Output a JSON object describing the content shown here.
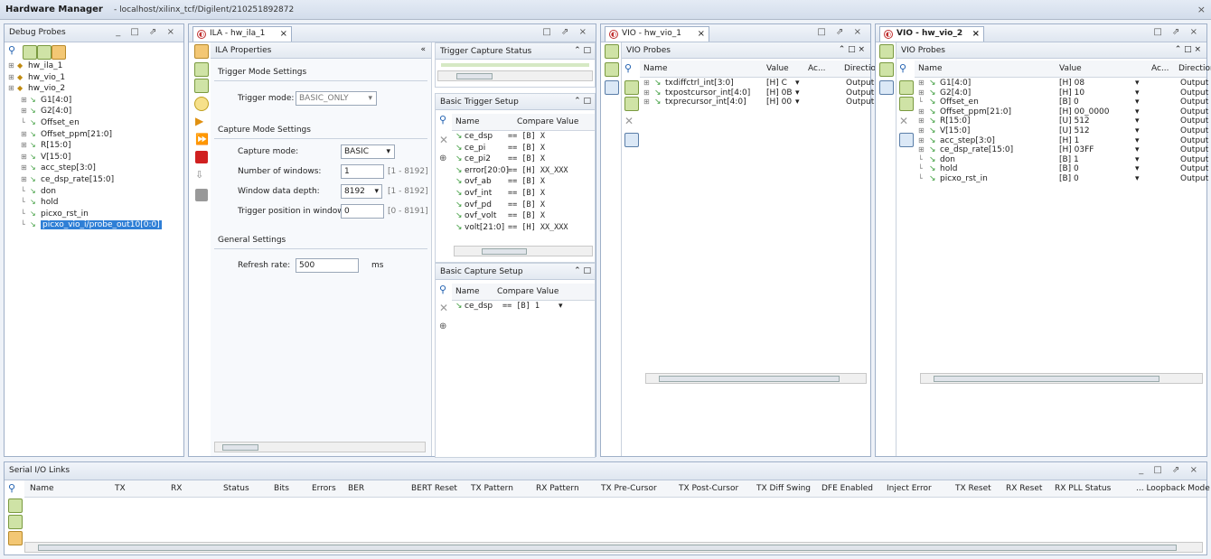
{
  "window": {
    "title": "Hardware Manager",
    "subtitle": "- localhost/xilinx_tcf/Digilent/210251892872",
    "close": "×"
  },
  "debug_probes": {
    "title": "Debug Probes",
    "controls": "_ □ ⇗ ×",
    "tree": [
      {
        "label": "hw_ila_1",
        "indent": 0,
        "kind": "core"
      },
      {
        "label": "hw_vio_1",
        "indent": 0,
        "kind": "core"
      },
      {
        "label": "hw_vio_2",
        "indent": 0,
        "kind": "core"
      },
      {
        "label": "G1[4:0]",
        "indent": 1,
        "kind": "bus"
      },
      {
        "label": "G2[4:0]",
        "indent": 1,
        "kind": "bus"
      },
      {
        "label": "Offset_en",
        "indent": 1,
        "kind": "sig"
      },
      {
        "label": "Offset_ppm[21:0]",
        "indent": 1,
        "kind": "bus"
      },
      {
        "label": "R[15:0]",
        "indent": 1,
        "kind": "bus"
      },
      {
        "label": "V[15:0]",
        "indent": 1,
        "kind": "bus"
      },
      {
        "label": "acc_step[3:0]",
        "indent": 1,
        "kind": "bus"
      },
      {
        "label": "ce_dsp_rate[15:0]",
        "indent": 1,
        "kind": "bus"
      },
      {
        "label": "don",
        "indent": 1,
        "kind": "sig"
      },
      {
        "label": "hold",
        "indent": 1,
        "kind": "sig"
      },
      {
        "label": "picxo_rst_in",
        "indent": 1,
        "kind": "sig"
      },
      {
        "label": "picxo_vio_i/probe_out10[0:0]",
        "indent": 1,
        "kind": "sig",
        "selected": true
      }
    ]
  },
  "ila_tab": {
    "label": "ILA - hw_ila_1",
    "close": "×",
    "properties_title": "ILA Properties",
    "collapse": "«",
    "trigger_mode_section": "Trigger Mode Settings",
    "trigger_mode_label": "Trigger mode:",
    "trigger_mode_value": "BASIC_ONLY",
    "capture_section": "Capture Mode Settings",
    "capture_mode_label": "Capture mode:",
    "capture_mode_value": "BASIC",
    "windows_label": "Number of windows:",
    "windows_value": "1",
    "windows_range": "[1 - 8192]",
    "depth_label": "Window data depth:",
    "depth_value": "8192",
    "depth_range": "[1 - 8192]",
    "trigpos_label": "Trigger position in window:",
    "trigpos_value": "0",
    "trigpos_range": "[0 - 8191]",
    "general_section": "General Settings",
    "refresh_label": "Refresh rate:",
    "refresh_value": "500",
    "refresh_unit": "ms",
    "trigger_status_title": "Trigger Capture Status",
    "basic_trigger_title": "Basic Trigger Setup",
    "bt_col_name": "Name",
    "bt_col_compare": "Compare Value",
    "bt_rows": [
      {
        "name": "ce_dsp",
        "value": "== [B] X"
      },
      {
        "name": "ce_pi",
        "value": "== [B] X"
      },
      {
        "name": "ce_pi2",
        "value": "== [B] X"
      },
      {
        "name": "error[20:0]",
        "value": "== [H] XX_XXX"
      },
      {
        "name": "ovf_ab",
        "value": "== [B] X"
      },
      {
        "name": "ovf_int",
        "value": "== [B] X"
      },
      {
        "name": "ovf_pd",
        "value": "== [B] X"
      },
      {
        "name": "ovf_volt",
        "value": "== [B] X"
      },
      {
        "name": "volt[21:0]",
        "value": "== [H] XX_XXX"
      }
    ],
    "basic_capture_title": "Basic Capture Setup",
    "bc_col_name": "Name",
    "bc_col_compare": "Compare Value",
    "bc_rows": [
      {
        "name": "ce_dsp",
        "value": "== [B] 1"
      }
    ]
  },
  "vio1_tab": {
    "label": "VIO - hw_vio_1",
    "close": "×",
    "probes_title": "VIO Probes",
    "cols": {
      "name": "Name",
      "value": "Value",
      "activity": "Ac...",
      "direction": "Directio"
    },
    "rows": [
      {
        "name": "txdiffctrl_int[3:0]",
        "value": "[H] C",
        "direction": "Output"
      },
      {
        "name": "txpostcursor_int[4:0]",
        "value": "[H] 0B",
        "direction": "Output"
      },
      {
        "name": "txprecursor_int[4:0]",
        "value": "[H] 00",
        "direction": "Output"
      }
    ]
  },
  "vio2_tab": {
    "label": "VIO - hw_vio_2",
    "close": "×",
    "probes_title": "VIO Probes",
    "cols": {
      "name": "Name",
      "value": "Value",
      "activity": "Ac...",
      "direction": "Direction"
    },
    "rows": [
      {
        "name": "G1[4:0]",
        "value": "[H] 08",
        "direction": "Output",
        "expand": true
      },
      {
        "name": "G2[4:0]",
        "value": "[H] 10",
        "direction": "Output",
        "expand": true
      },
      {
        "name": "Offset_en",
        "value": "[B] 0",
        "direction": "Output",
        "expand": false
      },
      {
        "name": "Offset_ppm[21:0]",
        "value": "[H] 00_0000",
        "direction": "Output",
        "expand": true
      },
      {
        "name": "R[15:0]",
        "value": "[U] 512",
        "direction": "Output",
        "expand": true
      },
      {
        "name": "V[15:0]",
        "value": "[U] 512",
        "direction": "Output",
        "expand": true
      },
      {
        "name": "acc_step[3:0]",
        "value": "[H] 1",
        "direction": "Output",
        "expand": true
      },
      {
        "name": "ce_dsp_rate[15:0]",
        "value": "[H] 03FF",
        "direction": "Output",
        "expand": true
      },
      {
        "name": "don",
        "value": "[B] 1",
        "direction": "Output",
        "expand": false
      },
      {
        "name": "hold",
        "value": "[B] 0",
        "direction": "Output",
        "expand": false
      },
      {
        "name": "picxo_rst_in",
        "value": "[B] 0",
        "direction": "Output",
        "expand": false
      }
    ]
  },
  "serial_io": {
    "title": "Serial I/O Links",
    "controls": "_ □ ⇗ ×",
    "columns": [
      "Name",
      "TX",
      "RX",
      "Status",
      "Bits",
      "Errors",
      "BER",
      "BERT Reset",
      "TX Pattern",
      "RX Pattern",
      "TX Pre-Cursor",
      "TX Post-Cursor",
      "TX Diff Swing",
      "DFE Enabled",
      "Inject Error",
      "TX Reset",
      "RX Reset",
      "RX PLL Status",
      "... Loopback Mode"
    ]
  },
  "colors": {
    "selection": "#2f7fd6",
    "accent": "#3a6ea5",
    "output_icon": "#3a9b3a"
  }
}
